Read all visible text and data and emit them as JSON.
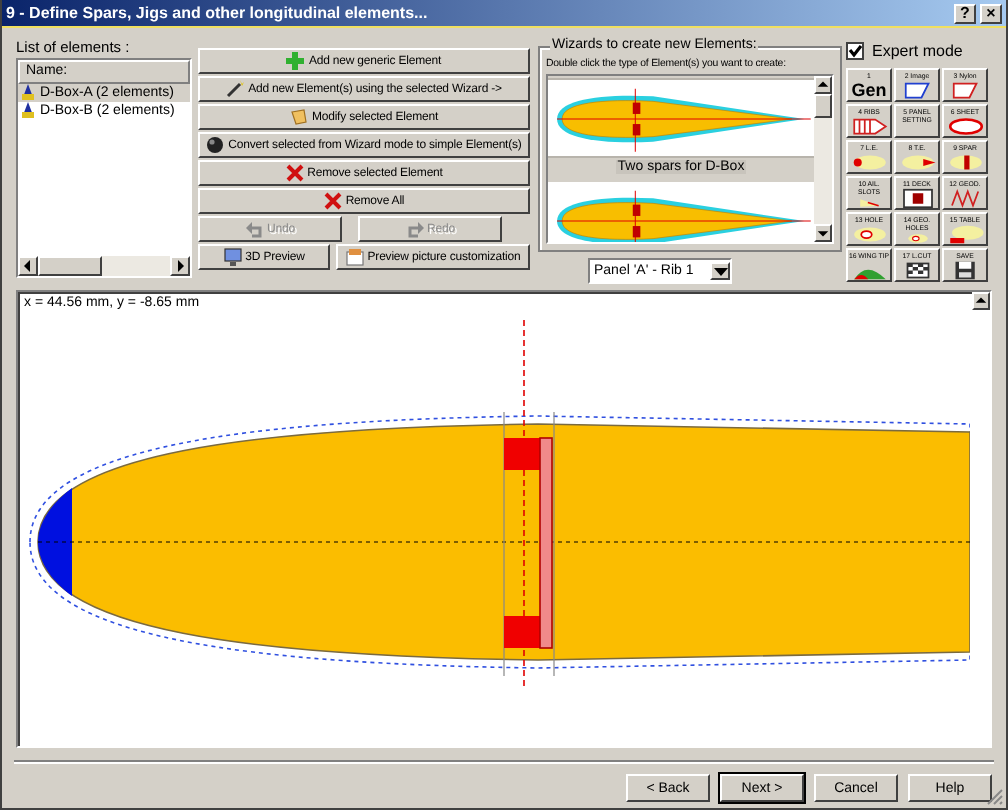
{
  "window": {
    "title": "9 - Define Spars, Jigs and other longitudinal elements...",
    "controls": [
      {
        "label": "?",
        "kind": "help"
      },
      {
        "label": "×",
        "kind": "close"
      }
    ]
  },
  "elements_list": {
    "label": "List of elements :",
    "column": "Name:",
    "items": [
      {
        "label": "D-Box-A (2 elements)",
        "selected": true
      },
      {
        "label": "D-Box-B (2 elements)",
        "selected": false
      }
    ]
  },
  "actions": [
    {
      "label": "Add new generic Element",
      "kind": "add",
      "disabled": false
    },
    {
      "label": "Add new Element(s) using the selected Wizard ->",
      "kind": "wand",
      "disabled": false
    },
    {
      "label": "Modify selected Element",
      "kind": "modify",
      "disabled": false
    },
    {
      "label": "Convert selected from Wizard mode to simple Element(s)",
      "kind": "convert",
      "disabled": false
    },
    {
      "label": "Remove selected Element",
      "kind": "remove",
      "disabled": false
    },
    {
      "label": "Remove All",
      "kind": "remove",
      "disabled": false
    }
  ],
  "history": [
    {
      "label": "Undo",
      "kind": "undo",
      "disabled": true
    },
    {
      "label": "Redo",
      "kind": "redo",
      "disabled": true
    }
  ],
  "preview_buttons": [
    {
      "label": "3D Preview",
      "kind": "monitor"
    },
    {
      "label": "Preview picture customization",
      "kind": "picture"
    }
  ],
  "wizards": {
    "label": "Wizards to create new Elements:",
    "hint": "Double click the  type of Element(s) you want to create:",
    "items": [
      {
        "caption": "Two spars for D-Box",
        "selected": true
      },
      {
        "selected": false
      }
    ]
  },
  "panel_select": {
    "value": "Panel 'A' - Rib 1"
  },
  "expert_mode": {
    "label": "Expert mode",
    "checked": true
  },
  "palette": [
    {
      "label": "1",
      "glyph": "Gen",
      "kind": "text"
    },
    {
      "label": "2 Image",
      "kind": "outline"
    },
    {
      "label": "3 Nylon",
      "kind": "outline-red"
    },
    {
      "label": "4 RIBS",
      "kind": "ribs"
    },
    {
      "label": "5 PANEL SETTING",
      "kind": "blank"
    },
    {
      "label": "6 SHEET",
      "kind": "sheet"
    },
    {
      "label": "7 L.E.",
      "kind": "le"
    },
    {
      "label": "8 T.E.",
      "kind": "te"
    },
    {
      "label": "9 SPAR",
      "kind": "spar"
    },
    {
      "label": "10 AIL. SLOTS",
      "kind": "slot"
    },
    {
      "label": "11 DECK",
      "kind": "deck"
    },
    {
      "label": "12 GEOD.",
      "kind": "zigzag"
    },
    {
      "label": "13 HOLE",
      "kind": "hole"
    },
    {
      "label": "14 GEO. HOLES",
      "kind": "hole"
    },
    {
      "label": "15 TABLE",
      "kind": "table"
    },
    {
      "label": "16 WING TIP",
      "kind": "tip"
    },
    {
      "label": "17 L.CUT",
      "kind": "flag"
    },
    {
      "label": "SAVE",
      "kind": "save"
    }
  ],
  "preview": {
    "coordinates": "x = 44.56 mm, y = -8.65 mm"
  },
  "footer_buttons": [
    {
      "label": "< Back",
      "default": false
    },
    {
      "label": "Next >",
      "default": true
    },
    {
      "label": "Cancel",
      "default": false
    },
    {
      "label": "Help",
      "default": false
    }
  ]
}
